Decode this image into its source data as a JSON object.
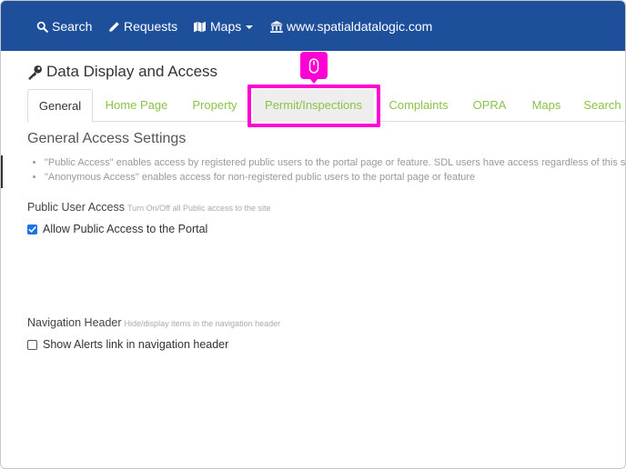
{
  "navbar": {
    "search_label": "Search",
    "requests_label": "Requests",
    "maps_label": "Maps",
    "site_label": "www.spatialdatalogic.com"
  },
  "page": {
    "title": "Data Display and Access"
  },
  "tabs": [
    {
      "label": "General",
      "active": true
    },
    {
      "label": "Home Page"
    },
    {
      "label": "Property"
    },
    {
      "label": "Permit/Inspections",
      "hover": true
    },
    {
      "label": "Complaints"
    },
    {
      "label": "OPRA"
    },
    {
      "label": "Maps"
    },
    {
      "label": "Search"
    }
  ],
  "general": {
    "section_title": "General Access Settings",
    "bullets": [
      "\"Public Access\" enables access by registered public users to the portal page or feature. SDL users have access regardless of this set",
      "\"Anonymous Access\" enables access for non-registered public users to the portal page or feature"
    ]
  },
  "public_user_access": {
    "label": "Public User Access",
    "hint": "Turn On/Off all Public access to the site",
    "checkbox_label": "Allow Public Access to the Portal",
    "checked": true
  },
  "navigation_header": {
    "label": "Navigation Header",
    "hint": "Hide/display items in the navigation header",
    "checkbox_label": "Show Alerts link in navigation header",
    "checked": false
  },
  "colors": {
    "navbar": "#1d4f9b",
    "tab_link": "#8bc34a",
    "highlight": "#ff00d4",
    "checkbox": "#1a73e8"
  }
}
